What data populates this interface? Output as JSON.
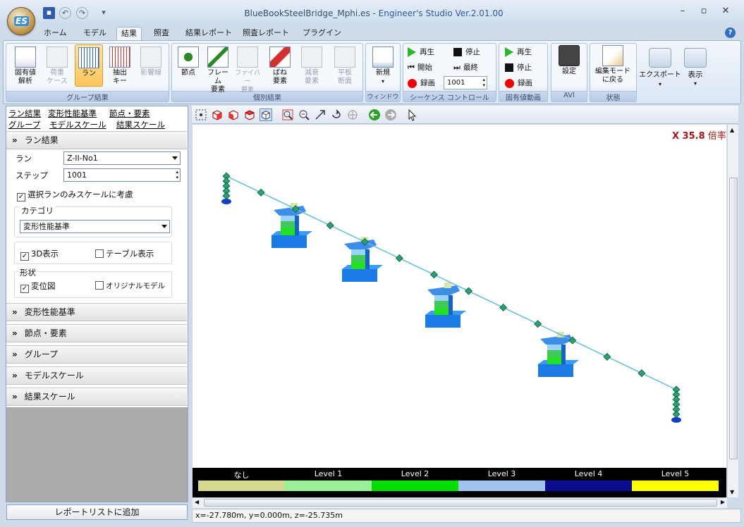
{
  "title": {
    "file": "BlueBookSteelBridge_Mphi.es",
    "separator": " - ",
    "app": "Engineer's Studio Ver.2.01.00"
  },
  "menu_tabs": [
    "ホーム",
    "モデル",
    "結果",
    "照査",
    "結果レポート",
    "照査レポート",
    "プラグイン"
  ],
  "ribbon": {
    "group_results": {
      "title": "グループ結果",
      "buttons": [
        "固有値\n解析",
        "荷重\nケース",
        "ラン",
        "抽出\nキー",
        "影響線"
      ]
    },
    "individual_results": {
      "title": "個別結果",
      "buttons": [
        "節点",
        "フレーム\n要素",
        "ファイバー\n要素",
        "ばね\n要素",
        "減衰\n要素",
        "平板\n断面"
      ]
    },
    "window": {
      "title": "ウィンドウ",
      "button": "新規"
    },
    "sequence": {
      "title": "シーケンス コントロール",
      "play": "再生",
      "stop": "停止",
      "start": "開始",
      "last": "最終",
      "record": "録画",
      "frame": "1001"
    },
    "eigen_animation": {
      "title": "固有値動画",
      "play": "再生",
      "stop": "停止",
      "record": "録画"
    },
    "avi": {
      "title": "AVI",
      "button": "設定"
    },
    "state": {
      "title": "状態",
      "button": "編集モード\nに戻る"
    },
    "export": "エクスポート",
    "display": "表示"
  },
  "left_links": [
    "ラン結果",
    "変形性能基準",
    "節点・要素",
    "グループ",
    "モデルスケール",
    "結果スケール"
  ],
  "run_section": {
    "header": "ラン結果",
    "run_label": "ラン",
    "run_value": "Z-II-No1",
    "step_label": "ステップ",
    "step_value": "1001",
    "scale_check": "選択ランのみスケールに考慮",
    "category_label": "カテゴリ",
    "category_value": "変形性能基準",
    "show3d": "3D表示",
    "table": "テーブル表示",
    "shape_label": "形状",
    "disp": "変位図",
    "original": "オリジナルモデル"
  },
  "collapsed_sections": [
    "変形性能基準",
    "節点・要素",
    "グループ",
    "モデルスケール",
    "結果スケール"
  ],
  "add_report": "レポートリストに追加",
  "scale_text": "X 35.8",
  "scale_unit": "倍率",
  "legend": [
    {
      "label": "なし",
      "color": "#d4d890"
    },
    {
      "label": "Level 1",
      "color": "#98f098"
    },
    {
      "label": "Level 2",
      "color": "#00e000"
    },
    {
      "label": "Level 3",
      "color": "#a0c4ec"
    },
    {
      "label": "Level 4",
      "color": "#0c0c90"
    },
    {
      "label": "Level 5",
      "color": "#ffff00"
    }
  ],
  "status": "x=-27.780m, y=0.000m, z=-25.735m"
}
